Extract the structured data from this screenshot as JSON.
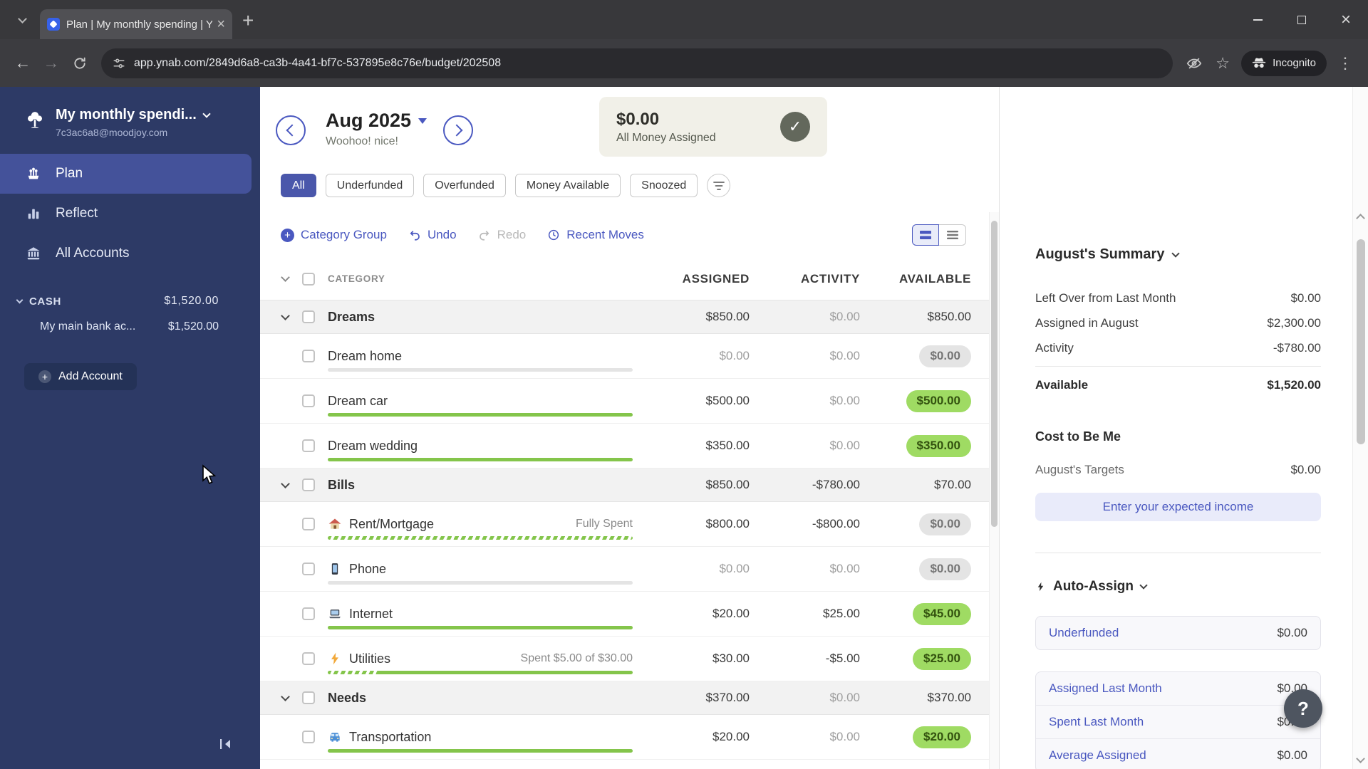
{
  "browser": {
    "tab_title": "Plan | My monthly spending | Y",
    "url": "app.ynab.com/2849d6a8-ca3b-4a41-bf7c-537895e8c76e/budget/202508",
    "incognito_label": "Incognito"
  },
  "sidebar": {
    "budget_name": "My monthly spendi...",
    "email": "7c3ac6a8@moodjoy.com",
    "nav": [
      {
        "label": "Plan",
        "icon": "plan-icon",
        "selected": true
      },
      {
        "label": "Reflect",
        "icon": "reflect-icon",
        "selected": false
      },
      {
        "label": "All Accounts",
        "icon": "accounts-icon",
        "selected": false
      }
    ],
    "cash_group": {
      "label": "CASH",
      "amount": "$1,520.00"
    },
    "accounts": [
      {
        "name": "My main bank ac...",
        "amount": "$1,520.00"
      }
    ],
    "add_account_label": "Add Account"
  },
  "header": {
    "month": "Aug 2025",
    "subtitle": "Woohoo! nice!",
    "banner_amount": "$0.00",
    "banner_label": "All Money Assigned"
  },
  "filters": [
    {
      "label": "All",
      "selected": true
    },
    {
      "label": "Underfunded",
      "selected": false
    },
    {
      "label": "Overfunded",
      "selected": false
    },
    {
      "label": "Money Available",
      "selected": false
    },
    {
      "label": "Snoozed",
      "selected": false
    }
  ],
  "toolbar": {
    "category_group": "Category Group",
    "undo": "Undo",
    "redo": "Redo",
    "recent_moves": "Recent Moves"
  },
  "table": {
    "headers": {
      "category": "CATEGORY",
      "assigned": "ASSIGNED",
      "activity": "ACTIVITY",
      "available": "AVAILABLE"
    },
    "groups": [
      {
        "name": "Dreams",
        "assigned": "$850.00",
        "activity": "$0.00",
        "available": "$850.00",
        "rows": [
          {
            "name": "Dream home",
            "assigned": "$0.00",
            "activity": "$0.00",
            "available": "$0.00",
            "pill": "gray",
            "progress": [
              {
                "style": "track",
                "pct": 100
              }
            ]
          },
          {
            "name": "Dream car",
            "assigned": "$500.00",
            "activity": "$0.00",
            "available": "$500.00",
            "pill": "green",
            "progress": [
              {
                "style": "solid",
                "pct": 100
              }
            ]
          },
          {
            "name": "Dream wedding",
            "assigned": "$350.00",
            "activity": "$0.00",
            "available": "$350.00",
            "pill": "green",
            "progress": [
              {
                "style": "solid",
                "pct": 100
              }
            ]
          }
        ]
      },
      {
        "name": "Bills",
        "assigned": "$850.00",
        "activity": "-$780.00",
        "available": "$70.00",
        "rows": [
          {
            "name": "Rent/Mortgage",
            "icon": "house-icon",
            "note": "Fully Spent",
            "assigned": "$800.00",
            "activity": "-$800.00",
            "available": "$0.00",
            "pill": "gray",
            "progress": [
              {
                "style": "striped",
                "pct": 100
              }
            ]
          },
          {
            "name": "Phone",
            "icon": "phone-icon",
            "assigned": "$0.00",
            "activity": "$0.00",
            "available": "$0.00",
            "pill": "gray",
            "progress": [
              {
                "style": "track",
                "pct": 100
              }
            ]
          },
          {
            "name": "Internet",
            "icon": "laptop-icon",
            "assigned": "$20.00",
            "activity": "$25.00",
            "available": "$45.00",
            "pill": "green",
            "progress": [
              {
                "style": "solid",
                "pct": 100
              }
            ]
          },
          {
            "name": "Utilities",
            "icon": "bolt-icon",
            "note": "Spent $5.00 of $30.00",
            "assigned": "$30.00",
            "activity": "-$5.00",
            "available": "$25.00",
            "pill": "green",
            "progress": [
              {
                "style": "striped",
                "pct": 17
              },
              {
                "style": "solid",
                "pct": 83
              }
            ]
          }
        ]
      },
      {
        "name": "Needs",
        "assigned": "$370.00",
        "activity": "$0.00",
        "available": "$370.00",
        "rows": [
          {
            "name": "Transportation",
            "icon": "bus-icon",
            "assigned": "$20.00",
            "activity": "$0.00",
            "available": "$20.00",
            "pill": "green",
            "progress": [
              {
                "style": "solid",
                "pct": 100
              }
            ]
          }
        ]
      }
    ]
  },
  "inspector": {
    "summary_title": "August's Summary",
    "summary_rows": [
      {
        "label": "Left Over from Last Month",
        "value": "$0.00"
      },
      {
        "label": "Assigned in August",
        "value": "$2,300.00"
      },
      {
        "label": "Activity",
        "value": "-$780.00"
      }
    ],
    "available_row": {
      "label": "Available",
      "value": "$1,520.00"
    },
    "cost_to_be_me": "Cost to Be Me",
    "targets_row": {
      "label": "August's Targets",
      "value": "$0.00"
    },
    "income_button": "Enter your expected income",
    "auto_assign_title": "Auto-Assign",
    "underfunded_row": {
      "label": "Underfunded",
      "value": "$0.00"
    },
    "history_rows": [
      {
        "label": "Assigned Last Month",
        "value": "$0.00"
      },
      {
        "label": "Spent Last Month",
        "value": "$0.00"
      },
      {
        "label": "Average Assigned",
        "value": "$0.00"
      }
    ],
    "help_label": "?"
  },
  "colors": {
    "accent": "#4a58c0",
    "sidebar_bg": "#2d3a66",
    "selected_nav_bg": "#44529a",
    "pill_green": "#9fdb63",
    "pill_gray": "#e4e4e4",
    "progress_green": "#84c54b",
    "banner_bg": "#f1f0e8",
    "chip_selected_bg": "#4a57ab"
  }
}
